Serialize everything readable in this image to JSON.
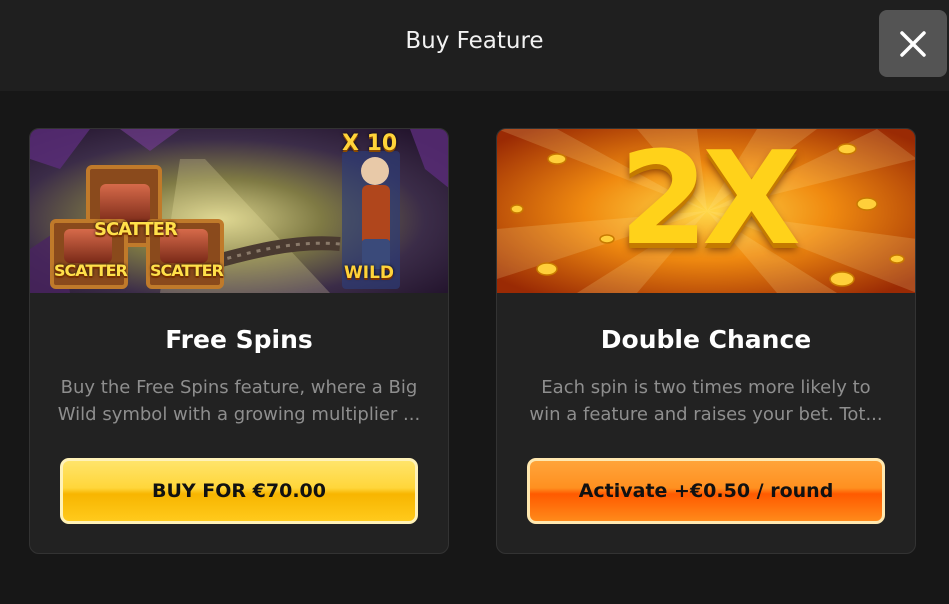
{
  "header": {
    "title": "Buy Feature",
    "close_icon": "close-icon"
  },
  "cards": [
    {
      "title": "Free Spins",
      "description_lines": [
        "Buy the Free Spins feature, where a Big",
        "Wild symbol with a growing multiplier ..."
      ],
      "button_label": "BUY FOR €70.00",
      "banner": {
        "multiplier_label": "X 10",
        "scatter_big": "SCATTER",
        "scatter_left": "SCATTER",
        "scatter_right": "SCATTER",
        "wild_label": "WILD"
      },
      "colors": {
        "button": "#ffd63a"
      }
    },
    {
      "title": "Double Chance",
      "description_lines": [
        "Each spin is two times more likely to",
        "win a feature and raises your bet. Tot..."
      ],
      "button_label": "Activate +€0.50 / round",
      "banner": {
        "big_label": "2X"
      },
      "colors": {
        "button": "#ff7a10"
      }
    }
  ]
}
